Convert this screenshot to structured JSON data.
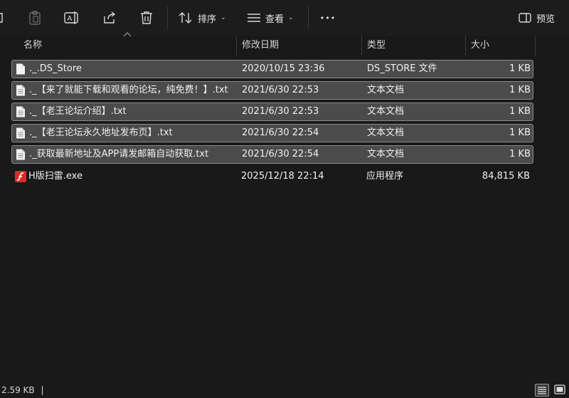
{
  "toolbar": {
    "sort_label": "排序",
    "view_label": "查看",
    "more_label": "•••",
    "preview_label": "预览"
  },
  "columns": {
    "name": "名称",
    "date": "修改日期",
    "type": "类型",
    "size": "大小"
  },
  "files": [
    {
      "name": "._.DS_Store",
      "date": "2020/10/15 23:36",
      "type": "DS_STORE 文件",
      "size": "1 KB",
      "selected": true,
      "icon": "file-icon"
    },
    {
      "name": "._【来了就能下载和观看的论坛，纯免费！】.txt",
      "date": "2021/6/30 22:53",
      "type": "文本文档",
      "size": "1 KB",
      "selected": true,
      "icon": "text-file-icon"
    },
    {
      "name": "._【老王论坛介绍】.txt",
      "date": "2021/6/30 22:53",
      "type": "文本文档",
      "size": "1 KB",
      "selected": true,
      "icon": "text-file-icon"
    },
    {
      "name": "._【老王论坛永久地址发布页】.txt",
      "date": "2021/6/30 22:54",
      "type": "文本文档",
      "size": "1 KB",
      "selected": true,
      "icon": "text-file-icon"
    },
    {
      "name": "._获取最新地址及APP请发邮箱自动获取.txt",
      "date": "2021/6/30 22:54",
      "type": "文本文档",
      "size": "1 KB",
      "selected": true,
      "icon": "text-file-icon"
    },
    {
      "name": "H版扫雷.exe",
      "date": "2025/12/18 22:14",
      "type": "应用程序",
      "size": "84,815 KB",
      "selected": false,
      "icon": "flash-exe-icon"
    }
  ],
  "status": {
    "text": "2.59 KB"
  },
  "colors": {
    "background": "#191919",
    "selection": "#4b4b4b",
    "exe_icon": "#d92b2b"
  }
}
